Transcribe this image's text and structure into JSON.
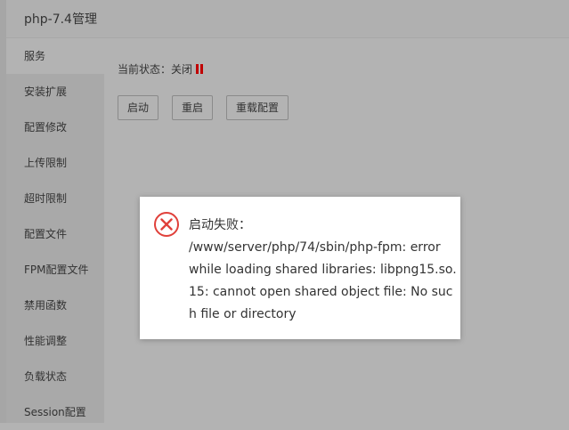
{
  "window": {
    "title": "php-7.4管理"
  },
  "sidebar": {
    "items": [
      {
        "label": "服务"
      },
      {
        "label": "安装扩展"
      },
      {
        "label": "配置修改"
      },
      {
        "label": "上传限制"
      },
      {
        "label": "超时限制"
      },
      {
        "label": "配置文件"
      },
      {
        "label": "FPM配置文件"
      },
      {
        "label": "禁用函数"
      },
      {
        "label": "性能调整"
      },
      {
        "label": "负载状态"
      },
      {
        "label": "Session配置"
      }
    ]
  },
  "service": {
    "status_label": "当前状态：",
    "status_value": "关闭",
    "buttons": {
      "start": "启动",
      "restart": "重启",
      "reload": "重载配置"
    }
  },
  "dialog": {
    "title": "启动失败：",
    "lines": [
      "/www/server/php/74/sbin/php-fpm: error",
      "while loading shared libraries: libpng15.so.",
      "15: cannot open shared object file: No suc",
      "h file or directory"
    ]
  },
  "colors": {
    "status_stopped": "#c00000",
    "error_icon": "#e0403a"
  }
}
